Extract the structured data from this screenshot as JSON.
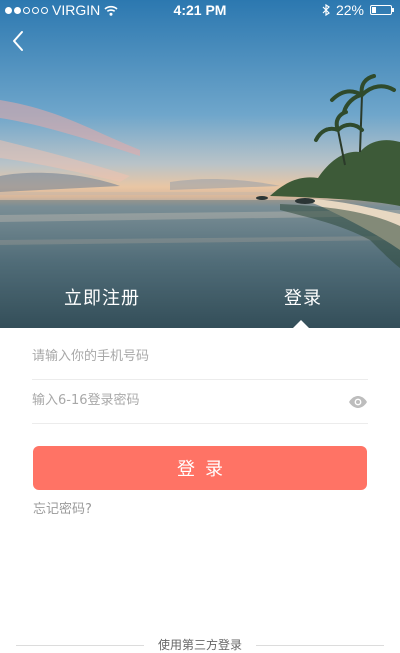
{
  "status_bar": {
    "carrier": "VIRGIN",
    "time": "4:21 PM",
    "battery": "22%",
    "battery_level": 0.22,
    "signal_bars": 2,
    "signal_total": 5
  },
  "header": {
    "back_icon": "chevron-left-icon",
    "tabs": [
      {
        "label": "立即注册",
        "active": false
      },
      {
        "label": "登录",
        "active": true
      }
    ]
  },
  "form": {
    "phone_placeholder": "请输入你的手机号码",
    "phone_value": "",
    "password_placeholder": "输入6-16登录密码",
    "password_value": "",
    "password_toggle_icon": "eye-icon",
    "login_button_label": "登录",
    "forgot_password_label": "忘记密码?"
  },
  "third_party": {
    "label": "使用第三方登录"
  },
  "colors": {
    "accent": "#ff7365",
    "placeholder": "#a8a8a8",
    "divider": "#ececec"
  }
}
